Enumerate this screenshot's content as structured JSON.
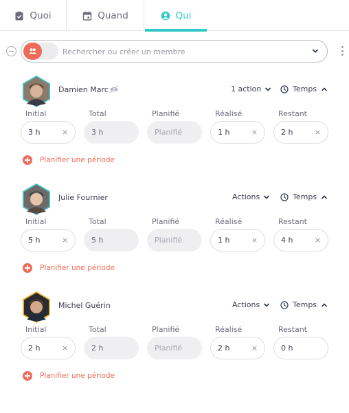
{
  "tabs": [
    {
      "label": "Quoi",
      "icon": "clipboard-check-icon",
      "active": false
    },
    {
      "label": "Quand",
      "icon": "calendar-icon",
      "active": false
    },
    {
      "label": "Qui",
      "icon": "user-circle-icon",
      "active": true
    }
  ],
  "colors": {
    "accent": "#2dc9c6",
    "primary_action": "#ef6b59",
    "text": "#3b3b4f",
    "muted": "#6b6b7b",
    "avatar_border_default": "#3fbcc4",
    "avatar_border_owner": "#e9b32f"
  },
  "search": {
    "placeholder": "Rechercher ou créer un membre",
    "value": "",
    "toggle_icon": "users-icon"
  },
  "field_labels": [
    "Initial",
    "Total",
    "Planifié",
    "Réalisé",
    "Restant"
  ],
  "members": [
    {
      "name": "Damien Marc",
      "hidden_icon": true,
      "avatar_border": "teal",
      "actions_label": "1 action",
      "temps_label": "Temps",
      "fields": {
        "initial": "3 h",
        "total": "3 h",
        "planifie": "Planifié",
        "realise": "1 h",
        "restant": "2 h"
      },
      "plan_label": "Planifier une période"
    },
    {
      "name": "Julie Fournier",
      "hidden_icon": false,
      "avatar_border": "teal",
      "actions_label": "Actions",
      "temps_label": "Temps",
      "fields": {
        "initial": "5 h",
        "total": "5 h",
        "planifie": "Planifié",
        "realise": "1 h",
        "restant": "4 h"
      },
      "plan_label": "Planifier une période"
    },
    {
      "name": "Michel Guérin",
      "hidden_icon": false,
      "avatar_border": "gold",
      "actions_label": "Actions",
      "temps_label": "Temps",
      "fields": {
        "initial": "2 h",
        "total": "2 h",
        "planifie": "Planifié",
        "realise": "2 h",
        "restant": "0 h"
      },
      "plan_label": "Planifier une période"
    }
  ]
}
